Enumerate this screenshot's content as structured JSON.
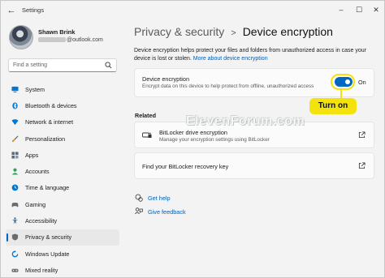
{
  "window": {
    "title": "Settings"
  },
  "profile": {
    "name": "Shawn Brink",
    "email_visible": "@outlook.com"
  },
  "search": {
    "placeholder": "Find a setting"
  },
  "sidebar": {
    "items": [
      {
        "label": "System",
        "icon": "monitor-icon",
        "color": "#0078d4"
      },
      {
        "label": "Bluetooth & devices",
        "icon": "bluetooth-icon",
        "color": "#0078d4"
      },
      {
        "label": "Network & internet",
        "icon": "wifi-icon",
        "color": "#0078d4"
      },
      {
        "label": "Personalization",
        "icon": "brush-icon",
        "color": "#e08a16"
      },
      {
        "label": "Apps",
        "icon": "apps-icon",
        "color": "#5a6b7c"
      },
      {
        "label": "Accounts",
        "icon": "person-icon",
        "color": "#2aa44f"
      },
      {
        "label": "Time & language",
        "icon": "globe-clock-icon",
        "color": "#0078d4"
      },
      {
        "label": "Gaming",
        "icon": "gamepad-icon",
        "color": "#6b6b6b"
      },
      {
        "label": "Accessibility",
        "icon": "accessibility-icon",
        "color": "#1a73c7"
      },
      {
        "label": "Privacy & security",
        "icon": "shield-icon",
        "color": "#6b6b6b",
        "active": true
      },
      {
        "label": "Windows Update",
        "icon": "update-icon",
        "color": "#0078d4"
      },
      {
        "label": "Mixed reality",
        "icon": "headset-icon",
        "color": "#6b6b6b"
      }
    ]
  },
  "breadcrumb": {
    "parent": "Privacy & security",
    "separator": ">",
    "current": "Device encryption"
  },
  "description": {
    "text": "Device encryption helps protect your files and folders from unauthorized access in case your device is lost or stolen.",
    "link": "More about device encryption"
  },
  "encryption": {
    "title": "Device encryption",
    "subtitle": "Encrypt data on this device to help protect from offline, unauthorized access",
    "toggle_state": "On",
    "accent": "#0067c0"
  },
  "callout": {
    "label": "Turn on",
    "color": "#f4e20d"
  },
  "related": {
    "title": "Related",
    "bitlocker": {
      "title": "BitLocker drive encryption",
      "subtitle": "Manage your encryption settings using BitLocker"
    },
    "recovery": {
      "title": "Find your BitLocker recovery key"
    }
  },
  "watermark": "ElevenForum.com",
  "help": {
    "get_help": "Get help",
    "feedback": "Give feedback"
  }
}
